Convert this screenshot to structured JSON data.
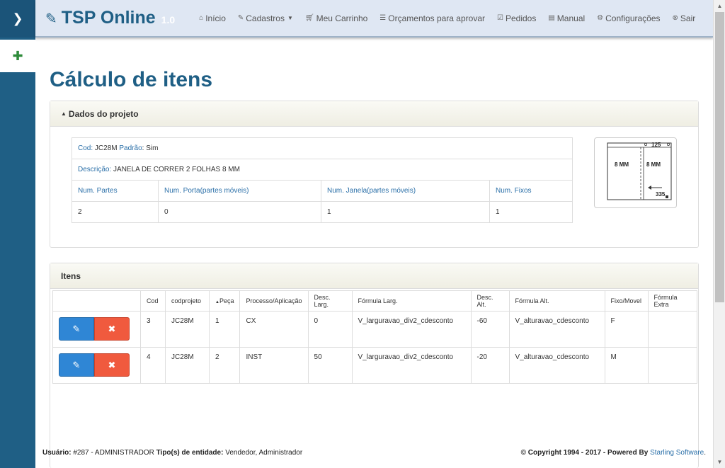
{
  "sidebar": {
    "toggle_icon": "chevron-right-icon",
    "add_icon": "plus-icon"
  },
  "brand": {
    "name": "TSP Online",
    "version": "1.0"
  },
  "nav": {
    "items": [
      {
        "label": "Início",
        "icon": "home-icon"
      },
      {
        "label": "Cadastros",
        "icon": "pencil-icon"
      },
      {
        "label": "Meu Carrinho",
        "icon": "cart-icon"
      },
      {
        "label": "Orçamentos para aprovar",
        "icon": "list-icon"
      },
      {
        "label": "Pedidos",
        "icon": "check-square-icon"
      },
      {
        "label": "Manual",
        "icon": "book-icon"
      },
      {
        "label": "Configurações",
        "icon": "gear-icon"
      },
      {
        "label": "Sair",
        "icon": "close-circle-icon"
      }
    ]
  },
  "page_title": "Cálculo de itens",
  "project_panel": {
    "heading": "Dados do projeto",
    "cod_label": "Cod",
    "cod_value": "JC28M",
    "padrao_label": "Padrão",
    "padrao_value": "Sim",
    "descricao_label": "Descrição",
    "descricao_value": "JANELA DE CORRER 2 FOLHAS 8 MM",
    "headers": [
      "Num. Partes",
      "Num. Porta(partes móveis)",
      "Num. Janela(partes móveis)",
      "Num. Fixos"
    ],
    "values": [
      "2",
      "0",
      "1",
      "1"
    ],
    "thumb": {
      "left_label": "8 MM",
      "right_label": "8 MM",
      "top_label": "125",
      "bottom_label": "335"
    }
  },
  "items_panel": {
    "heading": "Itens",
    "columns": [
      "",
      "Cod",
      "codprojeto",
      "Peça",
      "Processo/Aplicação",
      "Desc. Larg.",
      "Fórmula Larg.",
      "Desc. Alt.",
      "Fórmula Alt.",
      "Fixo/Movel",
      "Fórmula Extra"
    ],
    "rows": [
      {
        "cod": "3",
        "codprojeto": "JC28M",
        "peca": "1",
        "processo": "CX",
        "desc_larg": "0",
        "formula_larg": "V_larguravao_div2_cdesconto",
        "desc_alt": "-60",
        "formula_alt": "V_alturavao_cdesconto",
        "fixo": "F",
        "extra": ""
      },
      {
        "cod": "4",
        "codprojeto": "JC28M",
        "peca": "2",
        "processo": "INST",
        "desc_larg": "50",
        "formula_larg": "V_larguravao_div2_cdesconto",
        "desc_alt": "-20",
        "formula_alt": "V_alturavao_cdesconto",
        "fixo": "M",
        "extra": ""
      }
    ]
  },
  "footer": {
    "user_label": "Usuário:",
    "user_value": "#287 - ADMINISTRADOR",
    "entity_label": "Tipo(s) de entidade:",
    "entity_value": "Vendedor, Administrador",
    "copyright": "© Copyright 1994 - 2017 - Powered By",
    "company": "Starling Software",
    "period": "."
  }
}
